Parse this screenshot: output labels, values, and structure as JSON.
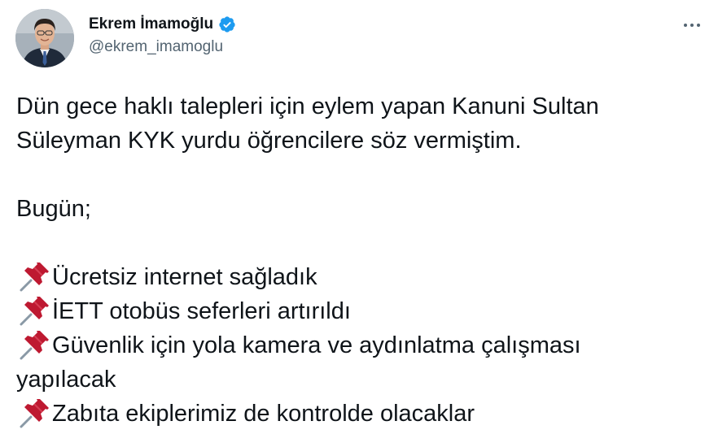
{
  "tweet": {
    "author": {
      "display_name": "Ekrem İmamoğlu",
      "handle": "@ekrem_imamoglu",
      "verified": true
    },
    "more_icon": "more-horizontal-icon",
    "body": {
      "intro_line1": "Dün gece haklı talepleri için eylem yapan Kanuni Sultan",
      "intro_line2": "Süleyman KYK yurdu öğrencilere söz vermiştim.",
      "today": "Bugün;",
      "bullet_icon": "pushpin-icon",
      "bullets": [
        "Ücretsiz internet sağladık",
        "İETT otobüs seferleri artırıldı",
        "Güvenlik için yola kamera ve aydınlatma çalışması",
        "Zabıta ekiplerimiz de kontrolde olacaklar"
      ],
      "bullet3_continuation": "yapılacak"
    },
    "colors": {
      "text": "#0f1419",
      "secondary_text": "#536471",
      "verified_blue": "#1d9bf0",
      "pushpin_red": "#be1931"
    }
  }
}
